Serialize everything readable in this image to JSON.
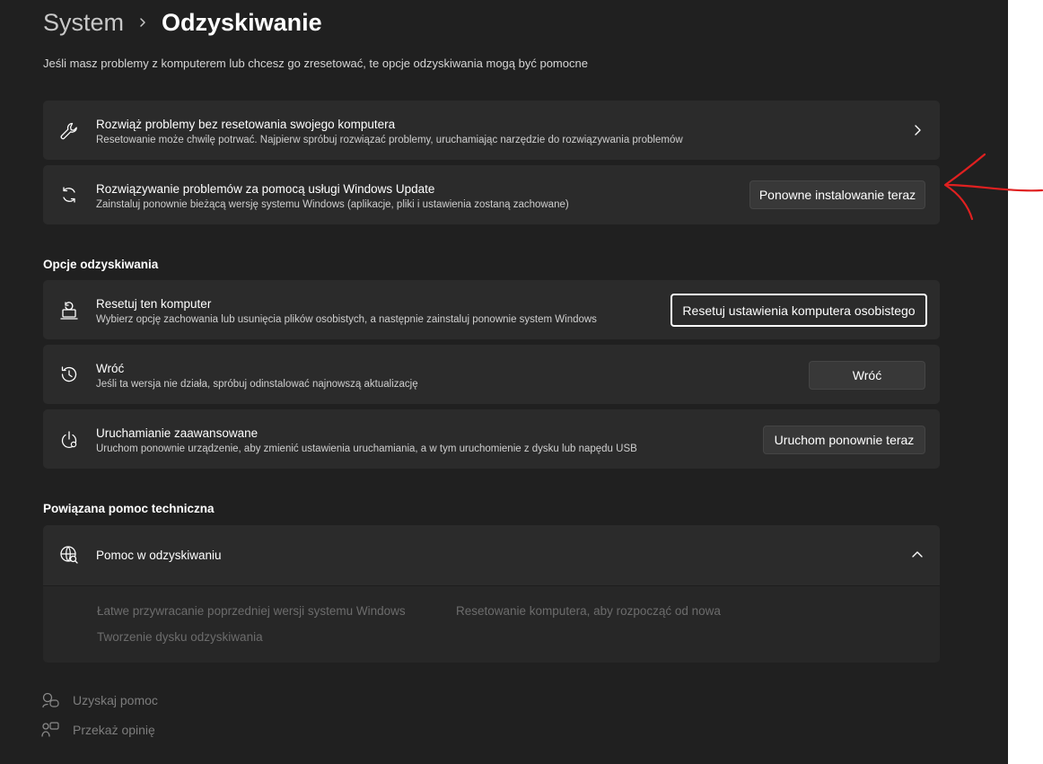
{
  "breadcrumb": {
    "parent": "System",
    "current": "Odzyskiwanie"
  },
  "subtitle": "Jeśli masz problemy z komputerem lub chcesz go zresetować, te opcje odzyskiwania mogą być pomocne",
  "troubleshoot": {
    "title": "Rozwiąż problemy bez resetowania swojego komputera",
    "desc": "Resetowanie może chwilę potrwać. Najpierw spróbuj rozwiązać problemy, uruchamiając narzędzie do rozwiązywania problemów",
    "icon": "wrench-icon"
  },
  "windows_update": {
    "title": "Rozwiązywanie problemów za pomocą usługi Windows Update",
    "desc": "Zainstaluj ponownie bieżącą wersję systemu Windows (aplikacje, pliki i ustawienia zostaną zachowane)",
    "button": "Ponowne instalowanie teraz",
    "icon": "sync-icon"
  },
  "recovery_section_title": "Opcje odzyskiwania",
  "reset": {
    "title": "Resetuj ten komputer",
    "desc": "Wybierz opcję zachowania lub usunięcia plików osobistych, a następnie zainstaluj ponownie system Windows",
    "button": "Resetuj ustawienia komputera osobistego",
    "icon": "reset-pc-icon"
  },
  "go_back": {
    "title": "Wróć",
    "desc": "Jeśli ta wersja nie działa, spróbuj odinstalować najnowszą aktualizację",
    "button": "Wróć",
    "icon": "history-icon"
  },
  "advanced": {
    "title": "Uruchamianie zaawansowane",
    "desc": "Uruchom ponownie urządzenie, aby zmienić ustawienia uruchamiania, a w tym uruchomienie z dysku lub napędu USB",
    "button": "Uruchom ponownie teraz",
    "icon": "power-settings-icon"
  },
  "related_section_title": "Powiązana pomoc techniczna",
  "help": {
    "title": "Pomoc w odzyskiwaniu",
    "icon": "globe-search-icon",
    "links": [
      "Łatwe przywracanie poprzedniej wersji systemu Windows",
      "Resetowanie komputera, aby rozpocząć od nowa",
      "Tworzenie dysku odzyskiwania"
    ]
  },
  "footer": {
    "get_help": "Uzyskaj pomoc",
    "feedback": "Przekaż opinię"
  },
  "colors": {
    "background": "#202020",
    "card": "#2b2b2b",
    "annotation": "#e02020"
  }
}
